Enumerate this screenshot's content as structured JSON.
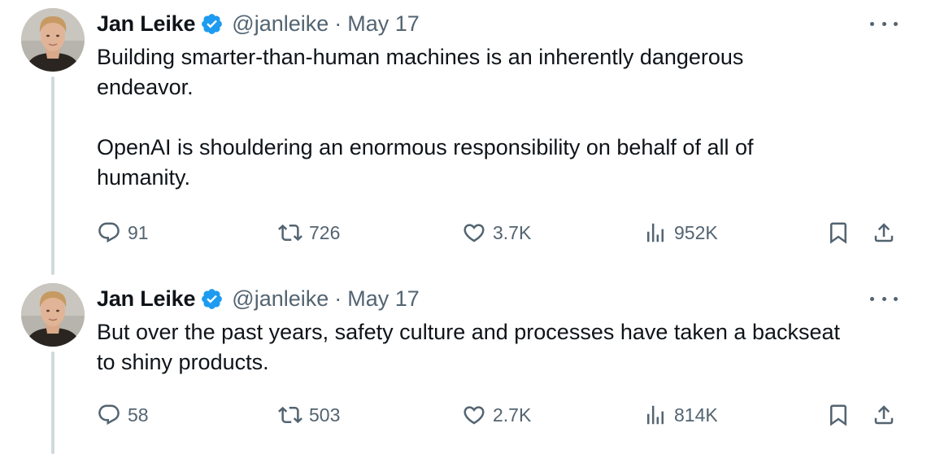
{
  "tweets": [
    {
      "author": "Jan Leike",
      "handle": "@janleike",
      "separator": "·",
      "date": "May 17",
      "paragraphs": [
        "Building smarter-than-human machines is an inherently dangerous endeavor.",
        "OpenAI is shouldering an enormous responsibility on behalf of all of humanity."
      ],
      "stats": {
        "replies": "91",
        "reposts": "726",
        "likes": "3.7K",
        "views": "952K"
      }
    },
    {
      "author": "Jan Leike",
      "handle": "@janleike",
      "separator": "·",
      "date": "May 17",
      "paragraphs": [
        "But over the past years, safety culture and processes have taken a backseat to shiny products."
      ],
      "stats": {
        "replies": "58",
        "reposts": "503",
        "likes": "2.7K",
        "views": "814K"
      }
    }
  ],
  "icons": {
    "verified": "verified-badge-icon",
    "reply": "reply-bubble-icon",
    "repost": "repost-arrows-icon",
    "like": "heart-icon",
    "views": "views-bars-icon",
    "bookmark": "bookmark-icon",
    "share": "share-upload-icon",
    "more": "more-dots-icon"
  },
  "colors": {
    "text": "#0f1419",
    "secondary": "#536471",
    "verified": "#1d9bf0",
    "thread_line": "#cfd9de"
  }
}
